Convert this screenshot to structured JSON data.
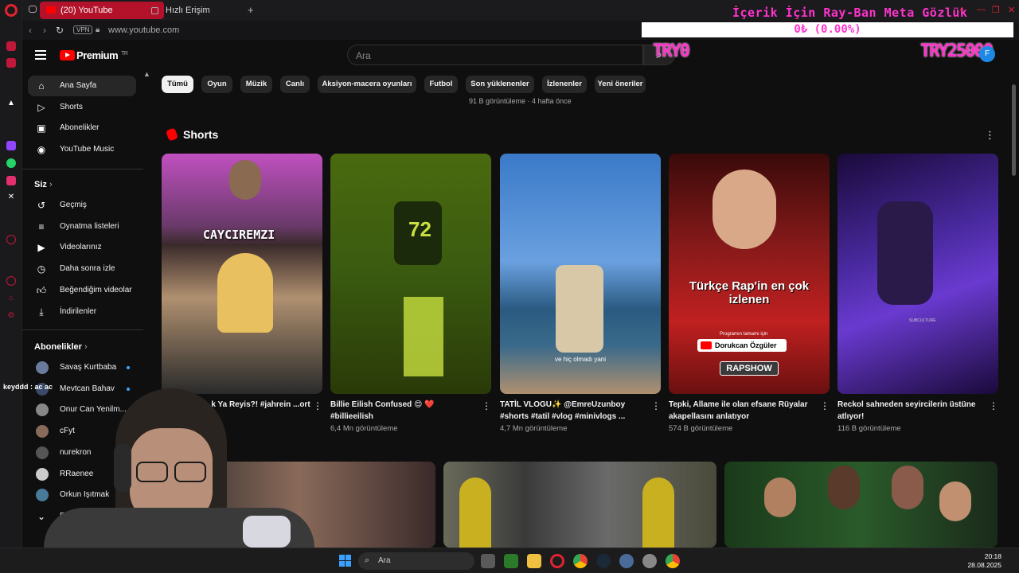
{
  "browser": {
    "tabs": [
      {
        "label": "(20) YouTube"
      },
      {
        "label": "Hızlı Erişim"
      }
    ],
    "url": "www.youtube.com",
    "vpn_label": "VPN"
  },
  "overlay": {
    "ticker": "İçerik İçin Ray-Ban Meta Gözlük",
    "progress_text": "0₺ (0.00%)",
    "progress": 0,
    "try_left": "TRY0",
    "try_right": "TRY25000",
    "chat_message": "keyddd : ac ac"
  },
  "youtube": {
    "brand": "Premium",
    "brand_country": "TR",
    "search_placeholder": "Ara",
    "avatar_letter": "F",
    "nav_main": [
      {
        "label": "Ana Sayfa",
        "icon": "home-icon"
      },
      {
        "label": "Shorts",
        "icon": "shorts-icon"
      },
      {
        "label": "Abonelikler",
        "icon": "subscriptions-icon"
      },
      {
        "label": "YouTube Music",
        "icon": "music-icon"
      }
    ],
    "section_you": "Siz",
    "nav_you": [
      {
        "label": "Geçmiş",
        "icon": "history-icon"
      },
      {
        "label": "Oynatma listeleri",
        "icon": "playlist-icon"
      },
      {
        "label": "Videolarınız",
        "icon": "your-videos-icon"
      },
      {
        "label": "Daha sonra izle",
        "icon": "watch-later-icon"
      },
      {
        "label": "Beğendiğim videolar",
        "icon": "like-icon"
      },
      {
        "label": "İndirilenler",
        "icon": "download-icon"
      }
    ],
    "section_subs": "Abonelikler",
    "subscriptions": [
      {
        "name": "Savaş Kurtbaba",
        "color": "#6a7a9a"
      },
      {
        "name": "Mevtcan Bahav",
        "color": "#3a4a6a"
      },
      {
        "name": "Onur Can Yenilm...",
        "color": "#888888"
      },
      {
        "name": "cFyt",
        "color": "#8a6a5a"
      },
      {
        "name": "nurekron",
        "color": "#555555"
      },
      {
        "name": "RRaenee",
        "color": "#cccccc"
      },
      {
        "name": "Orkun Işıtmak",
        "color": "#4a7a9a"
      }
    ],
    "more_label": "Daha fazla gö...",
    "chips": [
      "Tümü",
      "Oyun",
      "Müzik",
      "Canlı",
      "Aksiyon-macera oyunları",
      "Futbol",
      "Son yüklenenler",
      "İzlenenler",
      "Yeni öneriler"
    ],
    "prev_meta": "91 B görüntüleme · 4 hafta önce",
    "shorts_title": "Shorts",
    "shorts": [
      {
        "title": "...k Ya Reyis?! #jahrein ...ort",
        "views": "",
        "overlay": "CAYCIREMZI"
      },
      {
        "title": "Billie Eilish Confused 😍 ❤️ #billieeilish",
        "views": "6,4 Mn görüntüleme",
        "overlay": ""
      },
      {
        "title": "TATİL VLOGU✨ @EmreUzunboy #shorts #tatil #vlog #minivlogs ...",
        "views": "4,7 Mn görüntüleme",
        "overlay": "ve hiç olmadı yani"
      },
      {
        "title": "Tepki, Allame ile olan efsane Rüyalar akapellasını anlatıyor",
        "views": "574 B görüntüleme",
        "overlay": "Türkçe Rap'in en çok izlenen",
        "overlay_channel": "Dorukcan Özgüler",
        "overlay_tag": "RAPSHOW",
        "overlay_small": "Programın tamamı için"
      },
      {
        "title": "Reckol sahneden seyircilerin üstüne atlıyor!",
        "views": "116 B görüntüleme",
        "overlay": "SUBCULTURE"
      }
    ],
    "colors": {
      "accent": "#ff0000",
      "overlay_pink": "#ff33cc"
    }
  },
  "taskbar": {
    "search_label": "Ara",
    "time": "20:18",
    "date": "28.08.2025"
  }
}
